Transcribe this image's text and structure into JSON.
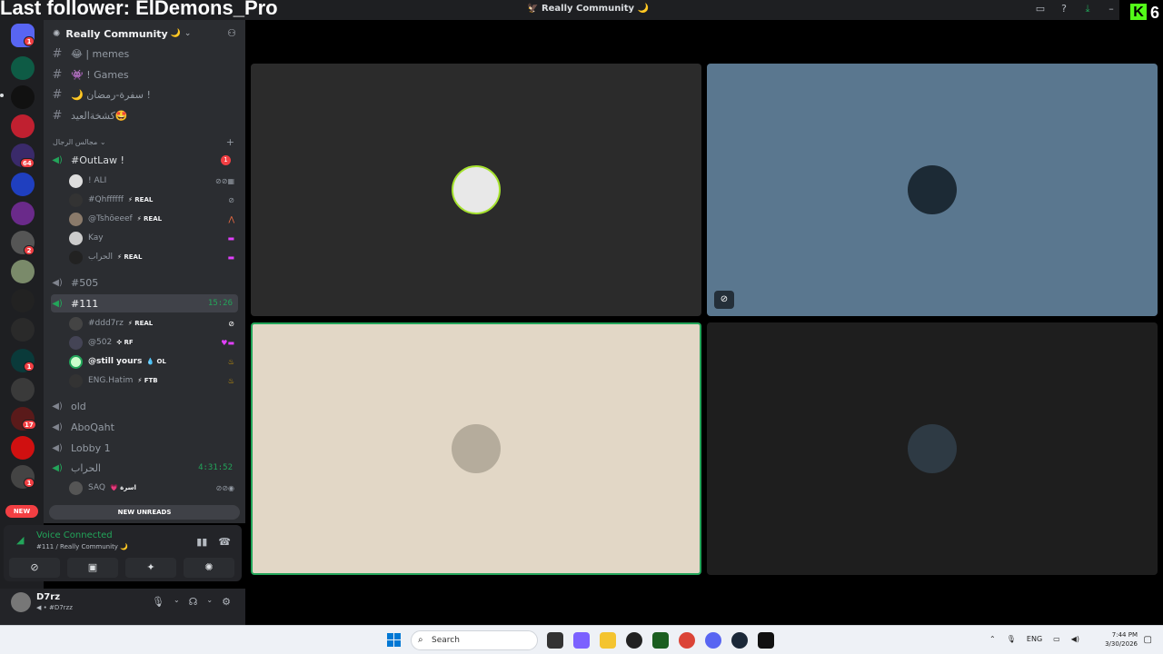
{
  "overlay": {
    "last_follower": "Last follower: ElDemons_Pro",
    "kick_letter": "K",
    "kick_count": "6"
  },
  "window": {
    "title": "Really Community",
    "title_emoji": "🌙"
  },
  "server": {
    "name": "Really Community",
    "name_emoji": "🌙"
  },
  "rail": {
    "badges": [
      "1",
      "1",
      "64",
      "2",
      "1",
      "1",
      "17",
      "1"
    ],
    "new_label": "NEW"
  },
  "channels": {
    "text": [
      "😂 | memes",
      "👾 ! Games",
      "🌙 سفرة-رمضان !",
      "كشخةالعيد🤩"
    ],
    "category": "مجالس الرجال",
    "voice": [
      {
        "name": "#OutLaw !",
        "badge": "1"
      },
      {
        "name": "#505"
      },
      {
        "name": "#111",
        "time": "15:26"
      },
      {
        "name": "old"
      },
      {
        "name": "AboQaht"
      },
      {
        "name": "Lobby 1"
      },
      {
        "name": "الحراب",
        "time": "4:31:52"
      }
    ],
    "outlaw_members": [
      {
        "name": "! ALI",
        "tag": ""
      },
      {
        "name": "#Qhffffff",
        "tag": "⚡ REAL"
      },
      {
        "name": "@Tshōeeef",
        "tag": "⚡ REAL"
      },
      {
        "name": "Kay",
        "tag": ""
      },
      {
        "name": "الحراب",
        "tag": "⚡ REAL"
      }
    ],
    "ch111_members": [
      {
        "name": "#ddd7rz",
        "tag": "⚡ REAL"
      },
      {
        "name": "@502",
        "tag": "✜ RF"
      },
      {
        "name": "@still yours",
        "tag": "💧 OL"
      },
      {
        "name": "ENG.Hatim",
        "tag": "⚡ FTB"
      }
    ],
    "harab_members": [
      {
        "name": "SAQ",
        "tag": "💗 اسرة"
      }
    ],
    "new_unreads": "NEW UNREADS"
  },
  "voice_panel": {
    "status": "Voice Connected",
    "location": "#111 / Really Community 🌙"
  },
  "user_panel": {
    "name": "D7rz",
    "status": "#D7rzz"
  },
  "taskbar": {
    "search_placeholder": "Search",
    "lang": "ENG",
    "time": "7:44 PM",
    "date": "3/30/2026"
  },
  "colors": {
    "green": "#23a55a",
    "red": "#f23f43",
    "tile_blue": "#5a778f",
    "tile_beige": "#e2d7c6",
    "kick_green": "#53fc18"
  },
  "icons": {
    "titlebar": [
      "inbox-icon",
      "help-icon",
      "download-icon",
      "minimize-icon"
    ],
    "voice_actions": [
      "camera-off-icon",
      "screen-share-icon",
      "activities-icon",
      "soundboard-icon"
    ],
    "user_controls": [
      "mic-icon",
      "headphones-icon",
      "settings-icon"
    ]
  }
}
